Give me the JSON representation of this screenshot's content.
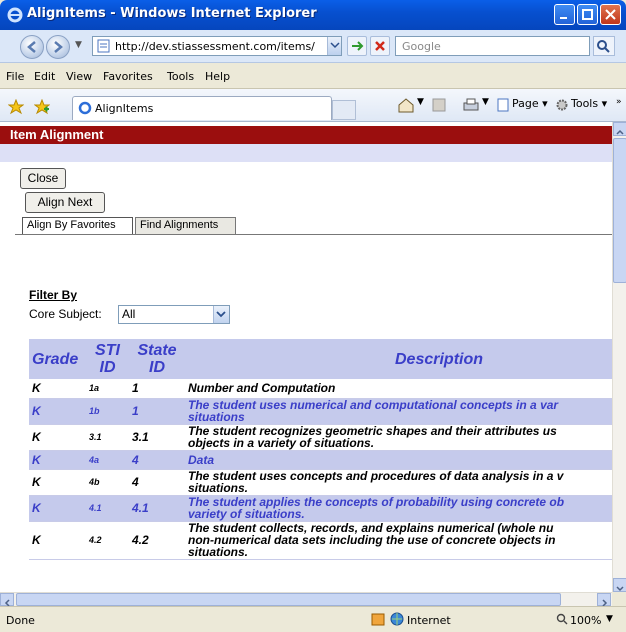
{
  "window": {
    "title": "AlignItems - Windows Internet Explorer"
  },
  "address_bar": {
    "url": "http://dev.stiassessment.com/items/AlignIte",
    "search_placeholder": "Google"
  },
  "menu": [
    "File",
    "Edit",
    "View",
    "Favorites",
    "Tools",
    "Help"
  ],
  "tab": {
    "label": "AlignItems"
  },
  "commands": {
    "page": "Page",
    "tools": "Tools"
  },
  "page": {
    "header": "Item Alignment",
    "close_label": "Close",
    "align_next_label": "Align Next",
    "tabs": [
      "Align By Favorites",
      "Find Alignments"
    ],
    "filter_by": "Filter By",
    "core_subject_label": "Core Subject:",
    "core_subject_value": "All",
    "columns": {
      "grade": "Grade",
      "sti_id_1": "STI",
      "sti_id_2": "ID",
      "state_id_1": "State",
      "state_id_2": "ID",
      "description": "Description"
    },
    "rows": [
      {
        "grade": "K",
        "sti": "1a",
        "state": "1",
        "desc1": "Number and Computation",
        "desc2": "",
        "desc3": "",
        "alt": false
      },
      {
        "grade": "K",
        "sti": "1b",
        "state": "1",
        "desc1": "The student uses numerical and computational concepts in a var",
        "desc2": "situations",
        "desc3": "",
        "alt": true
      },
      {
        "grade": "K",
        "sti": "3.1",
        "state": "3.1",
        "desc1": "The student recognizes geometric shapes and their attributes us",
        "desc2": "objects in a variety of situations.",
        "desc3": "",
        "alt": false
      },
      {
        "grade": "K",
        "sti": "4a",
        "state": "4",
        "desc1": "Data",
        "desc2": "",
        "desc3": "",
        "alt": true
      },
      {
        "grade": "K",
        "sti": "4b",
        "state": "4",
        "desc1": "The student uses concepts and procedures of data analysis in a v",
        "desc2": "situations.",
        "desc3": "",
        "alt": false
      },
      {
        "grade": "K",
        "sti": "4.1",
        "state": "4.1",
        "desc1": "The student applies the concepts of probability using concrete ob",
        "desc2": "variety of situations.",
        "desc3": "",
        "alt": true
      },
      {
        "grade": "K",
        "sti": "4.2",
        "state": "4.2",
        "desc1": "The student collects, records, and explains numerical (whole nu",
        "desc2": "non-numerical data sets including the use of concrete objects in",
        "desc3": "situations.",
        "alt": false
      }
    ]
  },
  "status": {
    "left": "Done",
    "zone": "Internet",
    "zoom": "100%"
  }
}
